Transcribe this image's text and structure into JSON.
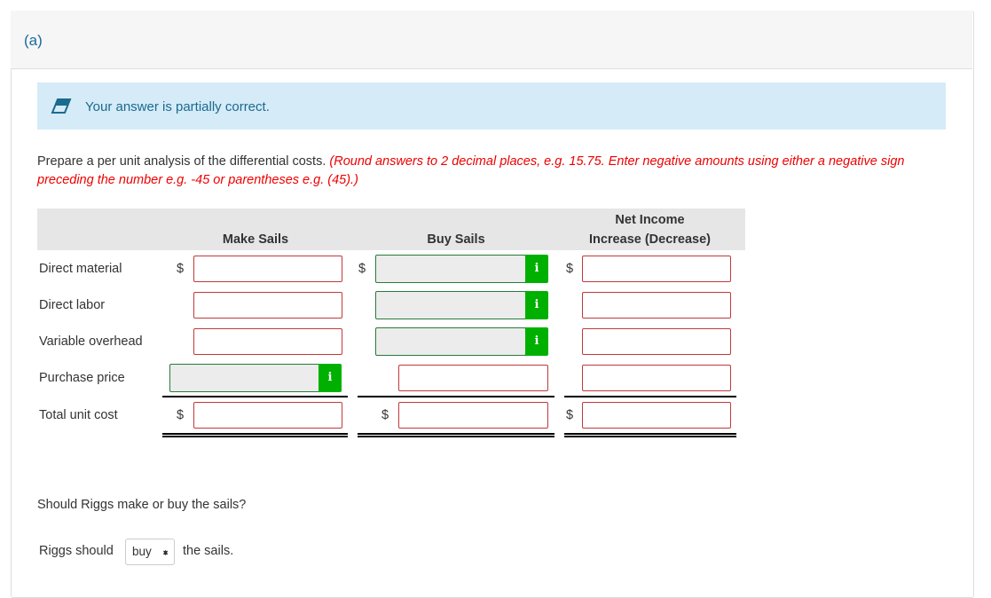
{
  "part_label": "(a)",
  "feedback": {
    "icon": "eraser-icon",
    "text": "Your answer is partially correct."
  },
  "instructions": {
    "text": "Prepare a per unit analysis of the differential costs.",
    "note": "(Round answers to 2 decimal places, e.g. 15.75. Enter negative amounts using either a negative sign preceding the number e.g. -45 or parentheses e.g. (45).)"
  },
  "table": {
    "headers": {
      "make": "Make Sails",
      "buy": "Buy Sails",
      "net_line1": "Net Income",
      "net_line2": "Increase (Decrease)"
    },
    "rows": [
      "Direct material",
      "Direct labor",
      "Variable overhead",
      "Purchase price",
      "Total unit cost"
    ],
    "currency": "$",
    "info_label": "i"
  },
  "question": "Should Riggs make or buy the sails?",
  "answer": {
    "prefix": "Riggs should",
    "selected": "buy",
    "suffix": "the sails."
  },
  "colors": {
    "error_border": "#c0393b",
    "correct_border": "#2a7a3a",
    "info_green": "#00b000",
    "banner": "#d5ebf7"
  }
}
